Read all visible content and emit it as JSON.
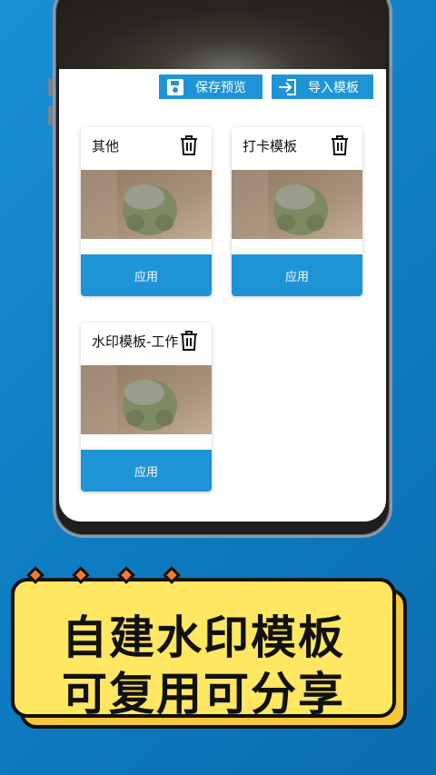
{
  "toolbar": {
    "save_label": "保存预览",
    "import_label": "导入模板"
  },
  "templates": [
    {
      "name": "其他",
      "apply_label": "应用"
    },
    {
      "name": "打卡模板",
      "apply_label": "应用"
    },
    {
      "name": "水印模板-工作",
      "apply_label": "应用"
    }
  ],
  "banner": {
    "line1": "自建水印模板",
    "line2": "可复用可分享"
  },
  "colors": {
    "accent": "#1e94d6",
    "background": "#1a8fd6",
    "banner_fill": "#ffe762",
    "banner_shadow": "#f6c63c",
    "diamond": "#f27a3a"
  },
  "icons": {
    "save": "save-icon",
    "import": "import-icon",
    "delete": "trash-icon"
  }
}
